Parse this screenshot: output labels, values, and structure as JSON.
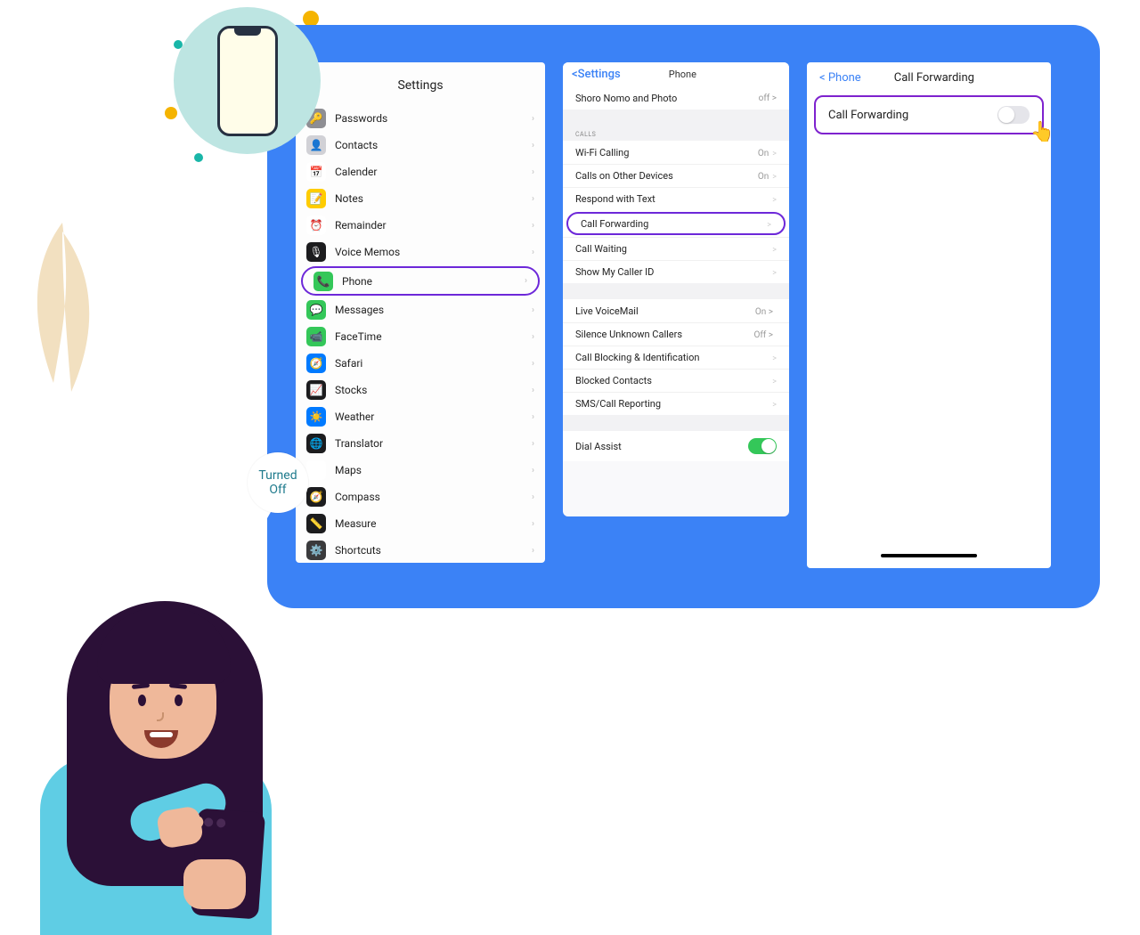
{
  "panel1": {
    "title": "Settings",
    "items": [
      {
        "icon_bg": "#8e8e93",
        "glyph": "🔑",
        "label": "Passwords"
      },
      {
        "icon_bg": "#d1d1d6",
        "glyph": "👤",
        "label": "Contacts"
      },
      {
        "icon_bg": "#ffffff",
        "glyph": "📅",
        "label": "Calender"
      },
      {
        "icon_bg": "#ffcc00",
        "glyph": "📝",
        "label": "Notes"
      },
      {
        "icon_bg": "#ffffff",
        "glyph": "⏰",
        "label": "Remainder"
      },
      {
        "icon_bg": "#1c1c1e",
        "glyph": "🎙",
        "label": "Voice Memos"
      },
      {
        "icon_bg": "#34c759",
        "glyph": "📞",
        "label": "Phone",
        "highlight": true
      },
      {
        "icon_bg": "#34c759",
        "glyph": "💬",
        "label": "Messages"
      },
      {
        "icon_bg": "#34c759",
        "glyph": "📹",
        "label": "FaceTime"
      },
      {
        "icon_bg": "#007aff",
        "glyph": "🧭",
        "label": "Safari"
      },
      {
        "icon_bg": "#1c1c1e",
        "glyph": "📈",
        "label": "Stocks"
      },
      {
        "icon_bg": "#007aff",
        "glyph": "☀️",
        "label": "Weather"
      },
      {
        "icon_bg": "#1c1c1e",
        "glyph": "🌐",
        "label": "Translator"
      },
      {
        "icon_bg": "#ffffff",
        "glyph": "🗺",
        "label": "Maps"
      },
      {
        "icon_bg": "#1c1c1e",
        "glyph": "🧭",
        "label": "Compass"
      },
      {
        "icon_bg": "#1c1c1e",
        "glyph": "📏",
        "label": "Measure"
      },
      {
        "icon_bg": "#3a3a3c",
        "glyph": "⚙️",
        "label": "Shortcuts"
      }
    ]
  },
  "panel2": {
    "back": "<Settings",
    "title": "Phone",
    "top": {
      "label": "Shoro Nomo and Photo",
      "value": "off >"
    },
    "section_label": "CALLS",
    "group1": [
      {
        "label": "Wi-Fi Calling",
        "value": "On",
        "chev": ">"
      },
      {
        "label": "Calls on Other Devices",
        "value": "On",
        "chev": ">"
      },
      {
        "label": "Respond with Text",
        "value": "",
        "chev": ">"
      },
      {
        "label": "Call Forwarding",
        "value": "",
        "chev": ">",
        "highlight": true
      },
      {
        "label": "Call Waiting",
        "value": "",
        "chev": ">"
      },
      {
        "label": "Show My Caller ID",
        "value": "",
        "chev": ">"
      }
    ],
    "group2": [
      {
        "label": "Live VoiceMail",
        "value": "On >",
        "chev": ""
      },
      {
        "label": "Silence Unknown Callers",
        "value": "Off >",
        "chev": ""
      },
      {
        "label": "Call Blocking & Identification",
        "value": "",
        "chev": ">"
      },
      {
        "label": "Blocked Contacts",
        "value": "",
        "chev": ">"
      },
      {
        "label": "SMS/Call Reporting",
        "value": "",
        "chev": ">"
      }
    ],
    "dial_assist": {
      "label": "Dial Assist",
      "on": true
    }
  },
  "panel3": {
    "back": "< Phone",
    "title": "Call Forwarding",
    "row_label": "Call Forwarding"
  },
  "speech": {
    "line1": "Turned",
    "line2": "Off"
  }
}
